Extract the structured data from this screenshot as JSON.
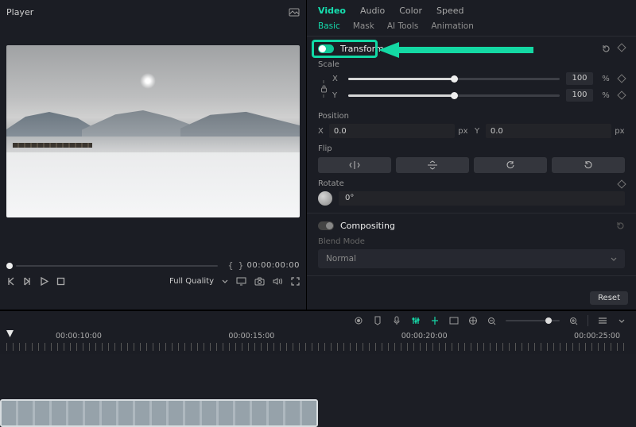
{
  "player": {
    "title": "Player",
    "timecode": "00:00:00:00",
    "quality": "Full Quality"
  },
  "tabs": {
    "top": [
      "Video",
      "Audio",
      "Color",
      "Speed"
    ],
    "activeTop": "Video",
    "sub": [
      "Basic",
      "Mask",
      "AI Tools",
      "Animation"
    ],
    "activeSub": "Basic"
  },
  "transform": {
    "title": "Transform",
    "scaleLabel": "Scale",
    "x": "X",
    "y": "Y",
    "scaleX": "100",
    "scaleY": "100",
    "unit": "%",
    "positionLabel": "Position",
    "posX": "0.0",
    "posY": "0.0",
    "px": "px",
    "flipLabel": "Flip",
    "rotateLabel": "Rotate",
    "rotateVal": "0°"
  },
  "compositing": {
    "title": "Compositing",
    "blendLabel": "Blend Mode",
    "blendValue": "Normal"
  },
  "footer": {
    "reset": "Reset"
  },
  "timeline": {
    "marks": [
      "00:00:10:00",
      "00:00:15:00",
      "00:00:20:00",
      "00:00:25:00"
    ]
  }
}
